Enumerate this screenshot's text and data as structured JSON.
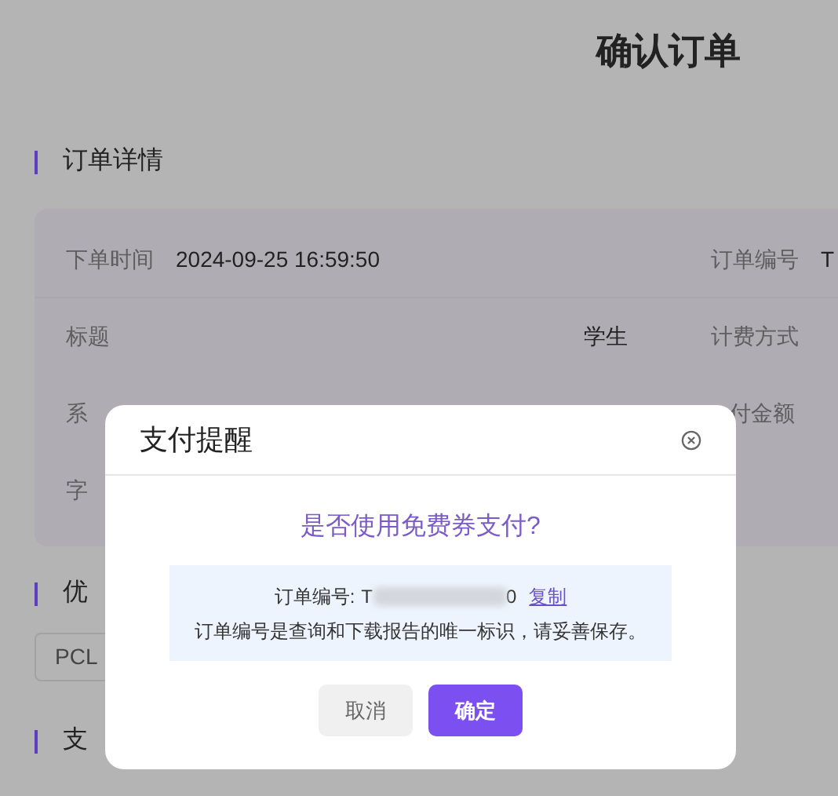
{
  "page_title": "确认订单",
  "order_details": {
    "heading": "订单详情",
    "rows": [
      {
        "label": "下单时间",
        "value": "2024-09-25 16:59:50",
        "right_label": "订单编号",
        "right_value": "T"
      },
      {
        "label": "标题",
        "value": "学生",
        "right_label": "计费方式"
      },
      {
        "label": "系",
        "right_label": "付金额"
      },
      {
        "label": "字"
      }
    ]
  },
  "coupon": {
    "heading": "优",
    "field_value": "PCL"
  },
  "payment": {
    "heading": "支"
  },
  "dialog": {
    "title": "支付提醒",
    "question": "是否使用免费券支付?",
    "order_label": "订单编号:",
    "order_number_start": "T",
    "order_number_end": "0",
    "copy_link": "复制",
    "note": "订单编号是查询和下载报告的唯一标识，请妥善保存。",
    "buttons": [
      {
        "label": "取消",
        "kind": "secondary"
      },
      {
        "label": "确定",
        "kind": "primary"
      }
    ]
  }
}
